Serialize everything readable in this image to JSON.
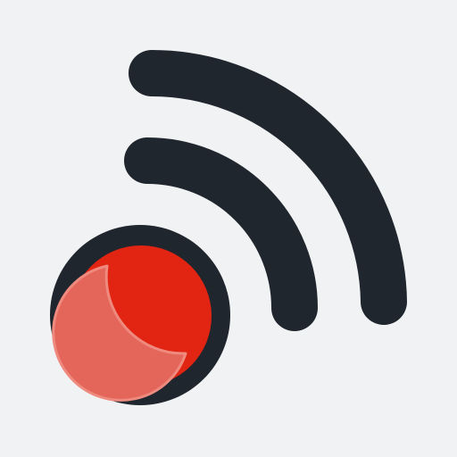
{
  "icon": {
    "name": "rss-feed-icon",
    "colors": {
      "background": "#f1f2f4",
      "outline": "#20262d",
      "dot_fill": "#e22412",
      "dot_highlight": "#e4665a",
      "dot_highlight_edge": "#ef8a7f"
    }
  }
}
